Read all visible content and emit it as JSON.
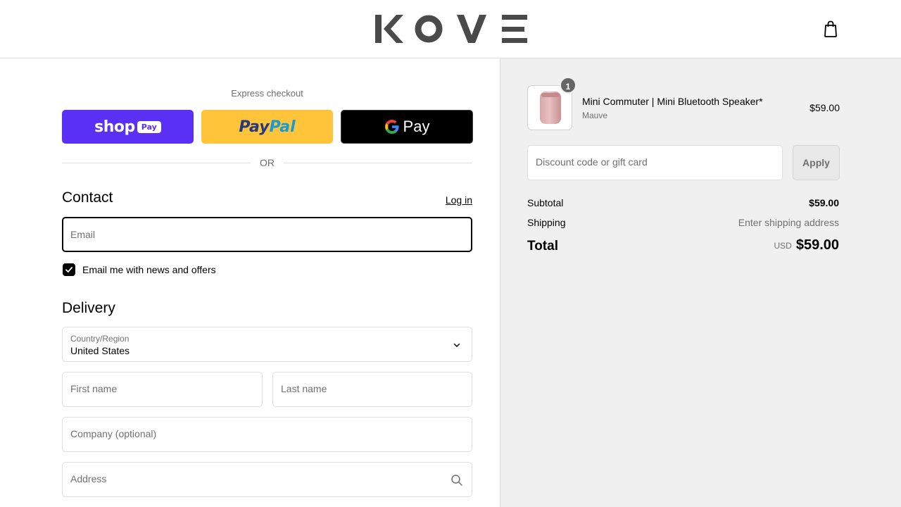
{
  "header": {
    "brand": "KOVE",
    "cart_icon": "shopping-bag-icon"
  },
  "express": {
    "label": "Express checkout",
    "shop_pay_word": "shop",
    "shop_pay_pill": "Pay",
    "paypal_pay": "Pay",
    "paypal_pal": "Pal",
    "gpay_g": "G",
    "gpay_text": "Pay",
    "or_text": "OR"
  },
  "contact": {
    "heading": "Contact",
    "login_link": "Log in",
    "email_placeholder": "Email",
    "newsletter_label": "Email me with news and offers",
    "newsletter_checked": true
  },
  "delivery": {
    "heading": "Delivery",
    "country_label": "Country/Region",
    "country_value": "United States",
    "first_name_placeholder": "First name",
    "last_name_placeholder": "Last name",
    "company_placeholder": "Company (optional)",
    "address_placeholder": "Address"
  },
  "order": {
    "item": {
      "quantity": "1",
      "name": "Mini Commuter | Mini Bluetooth Speaker*",
      "variant": "Mauve",
      "price": "$59.00"
    },
    "discount_placeholder": "Discount code or gift card",
    "apply_label": "Apply",
    "subtotal_label": "Subtotal",
    "subtotal_value": "$59.00",
    "shipping_label": "Shipping",
    "shipping_value": "Enter shipping address",
    "total_label": "Total",
    "currency": "USD",
    "total_value": "$59.00"
  },
  "colors": {
    "shop_pay": "#5a31f4",
    "paypal": "#ffc439",
    "gpay": "#000000",
    "summary_bg": "#f0f0f0"
  }
}
